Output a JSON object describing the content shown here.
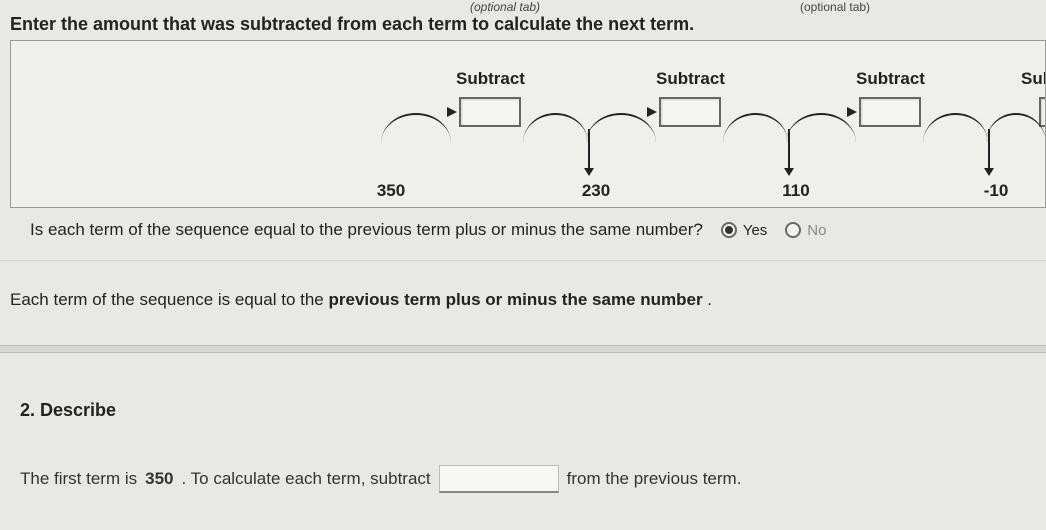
{
  "topLabels": {
    "left": "(optional tab)",
    "right": "(optional tab)"
  },
  "instruction": "Enter the amount that was subtracted from each term to calculate the next term.",
  "diagram": {
    "subtractLabel": "Subtract",
    "subtractLabelCut": "Subtr",
    "terms": [
      "350",
      "230",
      "110",
      "-10"
    ],
    "inputs": [
      "",
      "",
      "",
      ""
    ]
  },
  "question": {
    "text": "Is each term of the sequence equal to the previous term plus or minus the same number?",
    "yes": "Yes",
    "no": "No",
    "selected": "yes"
  },
  "statement": {
    "prefix": "Each term of the sequence is equal to the ",
    "bold": "previous term plus or minus the same number",
    "suffix": " ."
  },
  "section2": {
    "heading": "2. Describe",
    "line_pre": "The first term is ",
    "first_term": "350",
    "line_mid": " . To calculate each term, subtract",
    "line_post": "from the previous term.",
    "blank": ""
  }
}
